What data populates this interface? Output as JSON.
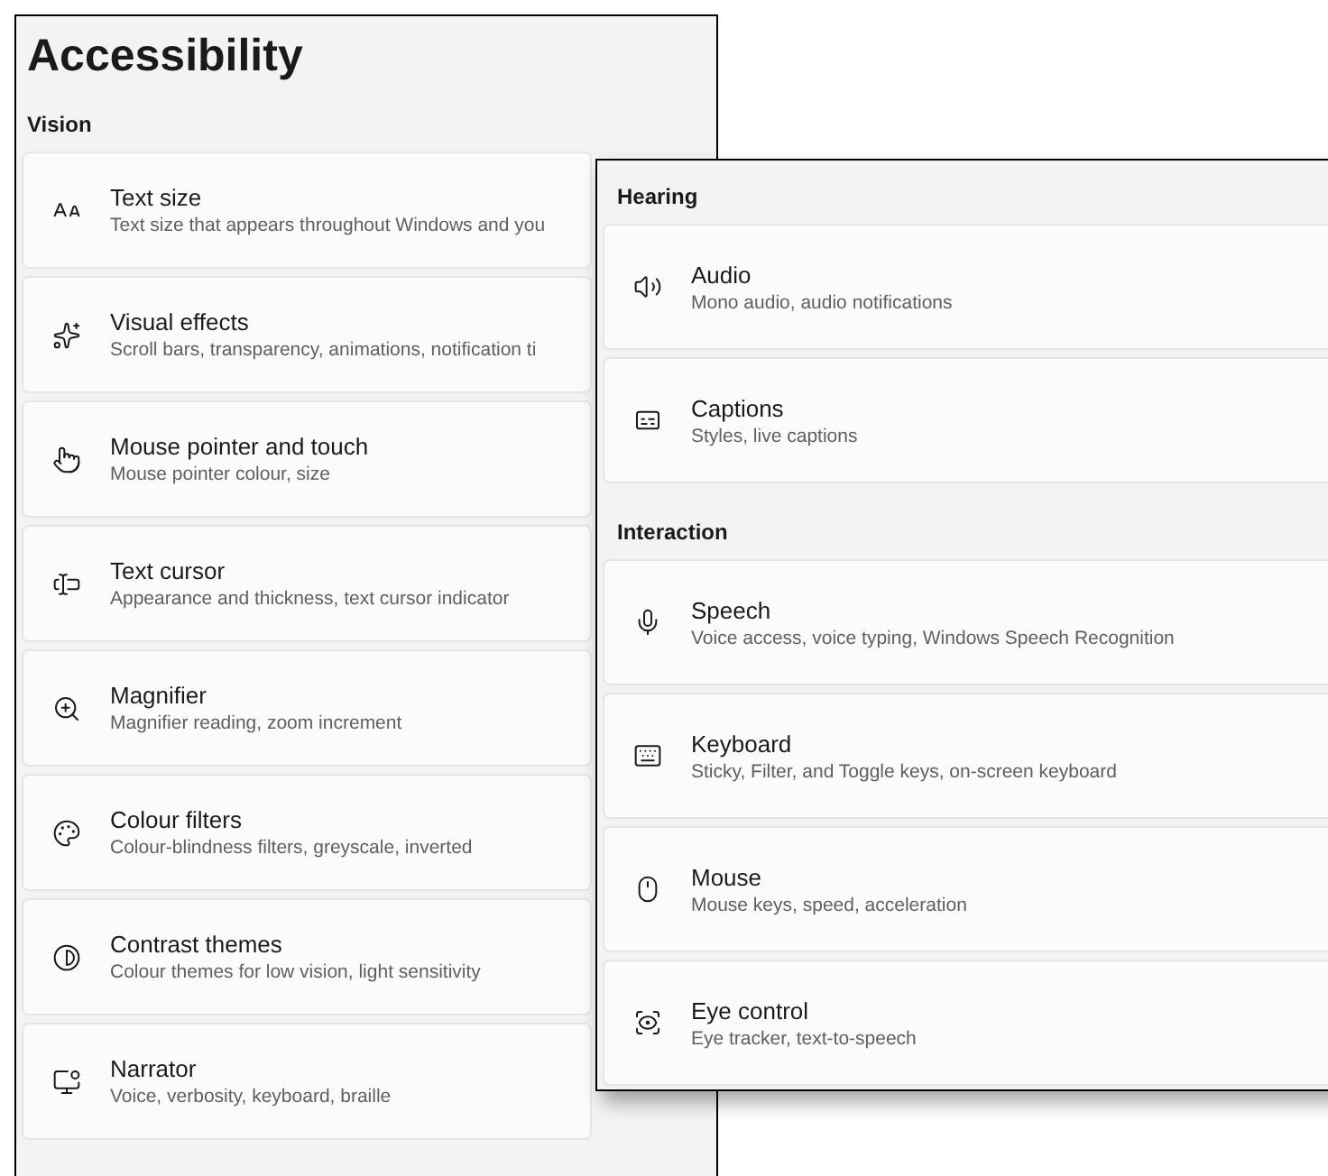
{
  "page": {
    "title": "Accessibility"
  },
  "vision": {
    "heading": "Vision",
    "items": [
      {
        "title": "Text size",
        "subtitle": "Text size that appears throughout Windows and you"
      },
      {
        "title": "Visual effects",
        "subtitle": "Scroll bars, transparency, animations, notification ti"
      },
      {
        "title": "Mouse pointer and touch",
        "subtitle": "Mouse pointer colour, size"
      },
      {
        "title": "Text cursor",
        "subtitle": "Appearance and thickness, text cursor indicator"
      },
      {
        "title": "Magnifier",
        "subtitle": "Magnifier reading, zoom increment"
      },
      {
        "title": "Colour filters",
        "subtitle": "Colour-blindness filters, greyscale, inverted"
      },
      {
        "title": "Contrast themes",
        "subtitle": "Colour themes for low vision, light sensitivity"
      },
      {
        "title": "Narrator",
        "subtitle": "Voice, verbosity, keyboard, braille"
      }
    ]
  },
  "hearing": {
    "heading": "Hearing",
    "items": [
      {
        "title": "Audio",
        "subtitle": "Mono audio, audio notifications"
      },
      {
        "title": "Captions",
        "subtitle": "Styles, live captions"
      }
    ]
  },
  "interaction": {
    "heading": "Interaction",
    "items": [
      {
        "title": "Speech",
        "subtitle": "Voice access, voice typing, Windows Speech Recognition"
      },
      {
        "title": "Keyboard",
        "subtitle": "Sticky, Filter, and Toggle keys, on-screen keyboard"
      },
      {
        "title": "Mouse",
        "subtitle": "Mouse keys, speed, acceleration"
      },
      {
        "title": "Eye control",
        "subtitle": "Eye tracker, text-to-speech"
      }
    ]
  }
}
